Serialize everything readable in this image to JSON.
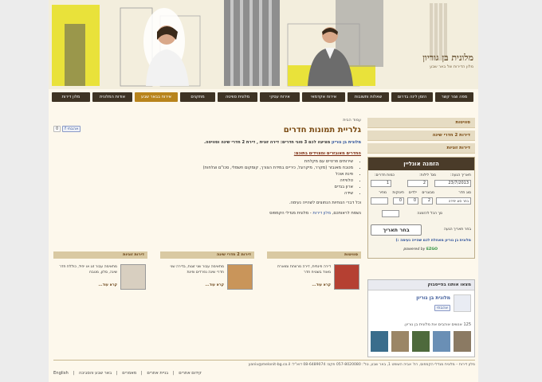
{
  "brand": {
    "name": "מלונית בן גוריון",
    "tagline": "מלון הדירות של באר שבע"
  },
  "nav": [
    {
      "label": "מלון דירות"
    },
    {
      "label": "אודות המלונית"
    },
    {
      "label": "אירוח בבאר שבע"
    },
    {
      "label": "מתקנים"
    },
    {
      "label": "מלונית סוויטה"
    },
    {
      "label": "אירוח עסקי"
    },
    {
      "label": "אירוח אקדמאי"
    },
    {
      "label": "שאלות ותשובות"
    },
    {
      "label": "הזמן לינה בדרום"
    },
    {
      "label": "מפה וצור קשר"
    }
  ],
  "content": {
    "breadcrumb": "עמוד הבית",
    "like_count": "0",
    "like_label": "אהבתי",
    "title": "גלריית תמונות חדרים",
    "intro_link": "מלונית בן גוריון",
    "intro": "מציעה לכם 3 סוגי חדרים: דירה זוגית , דירת 2 חדרי שינה וסוויטה.",
    "amenities_title": "החדרים מאובזרים ומצוידים בתוכם:",
    "amenities": [
      "שירותים פרטיים עם מקלחת",
      "מטבח מאובזר (מקרר, מיקרוגל, כיריים במידת הצורך, קומקום חשמלי, סכו\"ם וצלחות)",
      "פינת אוכל",
      "טלוויזיה",
      "ארון בגדים",
      "שידה"
    ],
    "note": "וכל דברי הנוחיות הנחוצים לשהייה נעימה.",
    "link_line_prefix": "נשמח לראותכם,",
    "link_line_link": "מלון דירות",
    "link_line_suffix": "- מלונית מגדלי הקמפוס"
  },
  "rooms": [
    {
      "title": "סוויטות",
      "text": "דירה פינתית, דירה מרווחת ומוארת מאוד בשטיח חדר",
      "more": "קרא עוד..."
    },
    {
      "title": "דירות 2 חדרי שינה",
      "text": "מתאימה עבור שני זוגות, בדירה שני חדרי שינה נפרדים ופינת",
      "more": "קרא עוד..."
    },
    {
      "title": "דירות זוגיות",
      "text": "מתאימה עבור זוג או יחיד, כוללת חדר שינה, סלון, מטבח",
      "more": "קרא עוד..."
    }
  ],
  "sidebar": {
    "links": [
      {
        "label": "סוויטות"
      },
      {
        "label": "דירות 2 חדרי שינה"
      },
      {
        "label": "דירות זוגיות"
      }
    ],
    "booking": {
      "title": "הזמנה אונליין",
      "arrival_label": "תאריך הגעה:",
      "arrival_value": "23/7/2013",
      "nights_label": "מס' לילות:",
      "nights_value": "2",
      "rooms_label": "כמות חדרים:",
      "rooms_value": "1",
      "room_type_label": "סוג חדר",
      "adults_label": "מבוגרים",
      "children_label": "ילדים",
      "infants_label": "תינוקות",
      "price_label": "מחיר",
      "room_type_value": "בחר סוג יחידה",
      "adults_value": "2",
      "children_value": "0",
      "infants_value": "0",
      "total_label": "סך הכל להזמנה",
      "choose_date_label": "בחר תאריך הגעה",
      "submit_label": "בחר תאריך",
      "secure_note": "מלונית בן גוריון מאחלת לכם שהייה נעימה :)",
      "powered_by": "powered by",
      "powered_brand": "EZGO"
    },
    "facebook": {
      "header": "מצאו אותנו בפייסבוק",
      "page_name": "מלונית בן גוריון",
      "like_label": "אהבתי",
      "fans_text": "125 אנשים אוהבים את מלונית בן גוריון."
    }
  },
  "footer": {
    "address": "מלון דירות – מלונית מגדלי הקמפוס, רח' אביה השופט 1, באר שבע, טל': 057-8020080 פקס: 08-6489074 דוא\"ל: yaniv@melonit-bg.co.il",
    "links": [
      "English",
      "קידום אתרים",
      "בניית אתרים",
      "מאמרים",
      "באר שבע והסביבה"
    ]
  },
  "colors": {
    "nav_bg": "#3e3324",
    "nav_active": "#b8841c",
    "title": "#7a4a12",
    "page_bg": "#fdf8ec"
  }
}
